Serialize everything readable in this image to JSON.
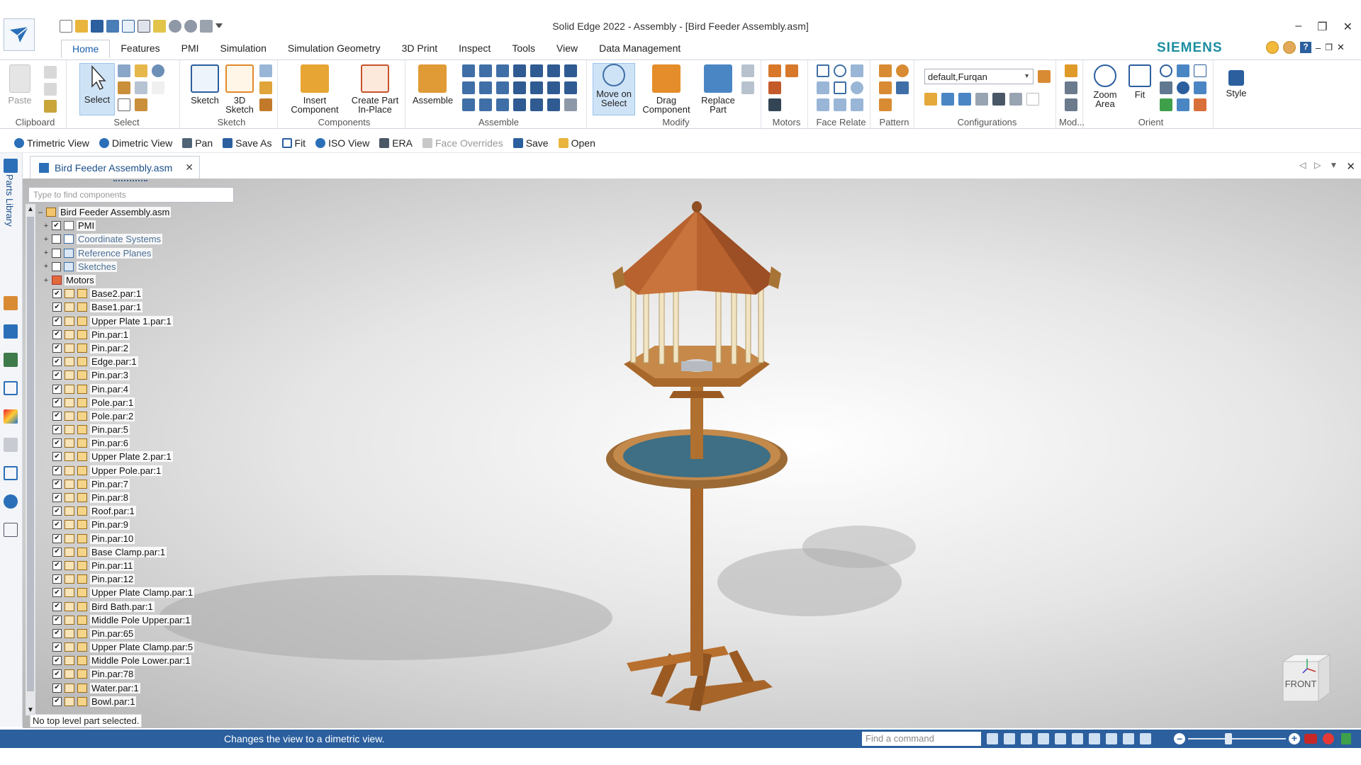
{
  "window": {
    "title": "Solid Edge 2022 - Assembly - [Bird Feeder Assembly.asm]",
    "brand": "SIEMENS",
    "accent": "#2b5f9e"
  },
  "menu_tabs": [
    "Home",
    "Features",
    "PMI",
    "Simulation",
    "Simulation Geometry",
    "3D Print",
    "Inspect",
    "Tools",
    "View",
    "Data Management"
  ],
  "ribbon": {
    "clipboard": {
      "paste": "Paste",
      "label": "Clipboard"
    },
    "select": {
      "select": "Select",
      "label": "Select"
    },
    "sketch": {
      "sketch": "Sketch",
      "sketch3d_1": "3D",
      "sketch3d_2": "Sketch",
      "label": "Sketch"
    },
    "components": {
      "insert_1": "Insert",
      "insert_2": "Component",
      "create_1": "Create Part",
      "create_2": "In-Place",
      "label": "Components"
    },
    "assemble": {
      "assemble": "Assemble",
      "label": "Assemble"
    },
    "modify": {
      "move_1": "Move on",
      "move_2": "Select",
      "drag_1": "Drag",
      "drag_2": "Component",
      "replace_1": "Replace",
      "replace_2": "Part",
      "label": "Modify"
    },
    "motors": {
      "label": "Motors"
    },
    "face_relate": {
      "label": "Face Relate"
    },
    "pattern": {
      "label": "Pattern"
    },
    "configurations": {
      "value": "default,Furqan",
      "label": "Configurations"
    },
    "mod": {
      "label": "Mod..."
    },
    "orient": {
      "zoom_1": "Zoom",
      "zoom_2": "Area",
      "fit": "Fit",
      "label": "Orient"
    },
    "style": {
      "style": "Style"
    }
  },
  "command_bar": [
    {
      "label": "Trimetric View",
      "icon": "trimetric-view-icon",
      "enabled": true
    },
    {
      "label": "Dimetric View",
      "icon": "dimetric-view-icon",
      "enabled": true
    },
    {
      "label": "Pan",
      "icon": "pan-icon",
      "enabled": true
    },
    {
      "label": "Save As",
      "icon": "save-as-icon",
      "enabled": true
    },
    {
      "label": "Fit",
      "icon": "fit-icon",
      "enabled": true
    },
    {
      "label": "ISO View",
      "icon": "iso-view-icon",
      "enabled": true
    },
    {
      "label": "ERA",
      "icon": "era-icon",
      "enabled": true
    },
    {
      "label": "Face Overrides",
      "icon": "face-overrides-icon",
      "enabled": false
    },
    {
      "label": "Save",
      "icon": "save-icon",
      "enabled": true
    },
    {
      "label": "Open",
      "icon": "open-icon",
      "enabled": true
    }
  ],
  "doc_tab": {
    "label": "Bird Feeder Assembly.asm"
  },
  "parts_library": {
    "label": "Parts Library"
  },
  "pathfinder": {
    "search_placeholder": "Type to find components",
    "root": "Bird Feeder Assembly.asm",
    "folders": [
      {
        "label": "PMI",
        "checked": true
      },
      {
        "label": "Coordinate Systems",
        "checked": false
      },
      {
        "label": "Reference Planes",
        "checked": false
      },
      {
        "label": "Sketches",
        "checked": false
      },
      {
        "label": "Motors",
        "checked": null
      }
    ],
    "parts": [
      "Base2.par:1",
      "Base1.par:1",
      "Upper Plate 1.par:1",
      "Pin.par:1",
      "Pin.par:2",
      "Edge.par:1",
      "Pin.par:3",
      "Pin.par:4",
      "Pole.par:1",
      "Pole.par:2",
      "Pin.par:5",
      "Pin.par:6",
      "Upper Plate 2.par:1",
      "Upper Pole.par:1",
      "Pin.par:7",
      "Pin.par:8",
      "Roof.par:1",
      "Pin.par:9",
      "Pin.par:10",
      "Base Clamp.par:1",
      "Pin.par:11",
      "Pin.par:12",
      "Upper Plate Clamp.par:1",
      "Bird Bath.par:1",
      "Middle Pole Upper.par:1",
      "Pin.par:65",
      "Upper Plate Clamp.par:5",
      "Middle Pole Lower.par:1",
      "Pin.par:78",
      "Water.par:1",
      "Bowl.par:1"
    ],
    "status": "No top level part selected."
  },
  "view_cube": {
    "face": "FRONT"
  },
  "status_bar": {
    "message": "Changes the view to a dimetric view.",
    "find_placeholder": "Find a command"
  }
}
